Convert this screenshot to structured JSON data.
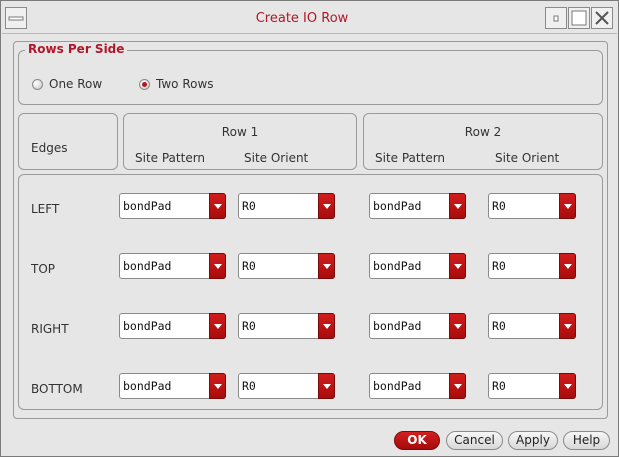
{
  "window": {
    "title": "Create IO Row"
  },
  "rows_per_side": {
    "legend": "Rows Per Side",
    "options": [
      {
        "label": "One Row",
        "selected": false
      },
      {
        "label": "Two Rows",
        "selected": true
      }
    ]
  },
  "headers": {
    "edges": "Edges",
    "row1": {
      "title": "Row 1",
      "site_pattern": "Site Pattern",
      "site_orient": "Site Orient"
    },
    "row2": {
      "title": "Row 2",
      "site_pattern": "Site Pattern",
      "site_orient": "Site Orient"
    }
  },
  "edges": [
    {
      "label": "LEFT",
      "row1_pattern": "bondPad",
      "row1_orient": "R0",
      "row2_pattern": "bondPad",
      "row2_orient": "R0"
    },
    {
      "label": "TOP",
      "row1_pattern": "bondPad",
      "row1_orient": "R0",
      "row2_pattern": "bondPad",
      "row2_orient": "R0"
    },
    {
      "label": "RIGHT",
      "row1_pattern": "bondPad",
      "row1_orient": "R0",
      "row2_pattern": "bondPad",
      "row2_orient": "R0"
    },
    {
      "label": "BOTTOM",
      "row1_pattern": "bondPad",
      "row1_orient": "R0",
      "row2_pattern": "bondPad",
      "row2_orient": "R0"
    }
  ],
  "buttons": {
    "ok": "OK",
    "cancel": "Cancel",
    "apply": "Apply",
    "help": "Help"
  },
  "colors": {
    "accent": "#b0182a",
    "combo_arrow": "#c01414"
  }
}
